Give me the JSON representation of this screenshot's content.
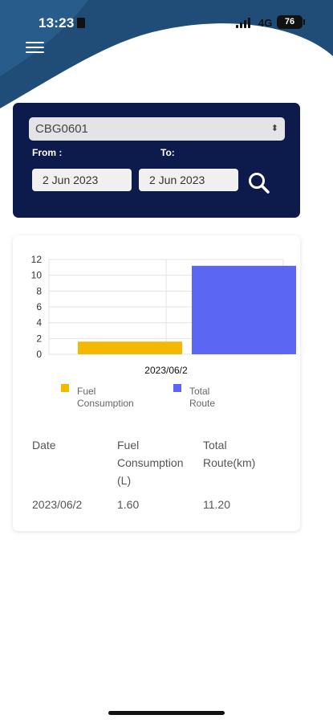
{
  "status_bar": {
    "time": "13:23",
    "network": "4G",
    "battery": "76"
  },
  "filter": {
    "vehicle": "CBG0601",
    "from_label": "From :",
    "to_label": "To:",
    "from_date": "2 Jun 2023",
    "to_date": "2 Jun 2023"
  },
  "chart_data": {
    "type": "bar",
    "categories": [
      "2023/06/2"
    ],
    "series": [
      {
        "name": "Fuel Consumption",
        "values": [
          1.6
        ],
        "color": "#f5b800"
      },
      {
        "name": "Total Route",
        "values": [
          11.2
        ],
        "color": "#5b67f2"
      }
    ],
    "yticks": [
      0,
      2,
      4,
      6,
      8,
      10,
      12
    ],
    "ylim": [
      0,
      12
    ],
    "grid": true,
    "legend_position": "bottom"
  },
  "legend": {
    "fuel_line1": "Fuel",
    "fuel_line2": "Consumption",
    "route": "Total Route"
  },
  "table": {
    "headers": [
      [
        "Date"
      ],
      [
        "Fuel",
        "Consumption",
        "(L)"
      ],
      [
        "Total",
        "Route(km)"
      ]
    ],
    "rows": [
      [
        "2023/06/2",
        "1.60",
        "11.20"
      ]
    ]
  },
  "colors": {
    "navy": "#0d1b4c",
    "wave": "#1f4d78",
    "fuel": "#f5b800",
    "route": "#5b67f2"
  }
}
